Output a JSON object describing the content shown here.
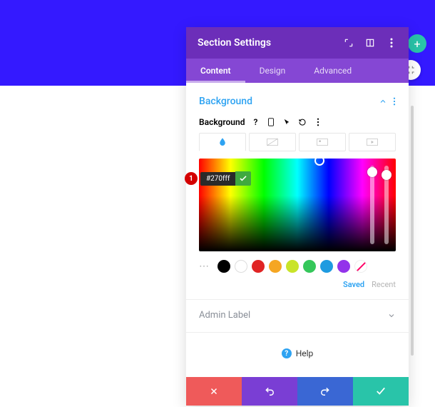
{
  "header": {
    "title": "Section Settings",
    "icons": [
      "expand-icon",
      "preview-icon",
      "kebab-icon"
    ]
  },
  "tabs": [
    {
      "label": "Content",
      "active": true
    },
    {
      "label": "Design",
      "active": false
    },
    {
      "label": "Advanced",
      "active": false
    }
  ],
  "section": {
    "title": "Background",
    "field_label": "Background",
    "bg_tabs": [
      "color-icon",
      "gradient-icon",
      "image-icon",
      "video-icon"
    ]
  },
  "color_picker": {
    "hex_value": "#270fff",
    "badge": "1"
  },
  "swatches": [
    "#000000",
    "outline",
    "#e02424",
    "#f5a623",
    "#c9e429",
    "#35c75a",
    "#1e9be0",
    "#9333ea",
    "cross"
  ],
  "swatch_tabs": {
    "saved": "Saved",
    "recent": "Recent"
  },
  "admin_label": {
    "title": "Admin Label"
  },
  "help": {
    "label": "Help"
  },
  "footer": {
    "cancel": "cancel",
    "undo": "undo",
    "redo": "redo",
    "save": "save"
  },
  "add_button": "+"
}
